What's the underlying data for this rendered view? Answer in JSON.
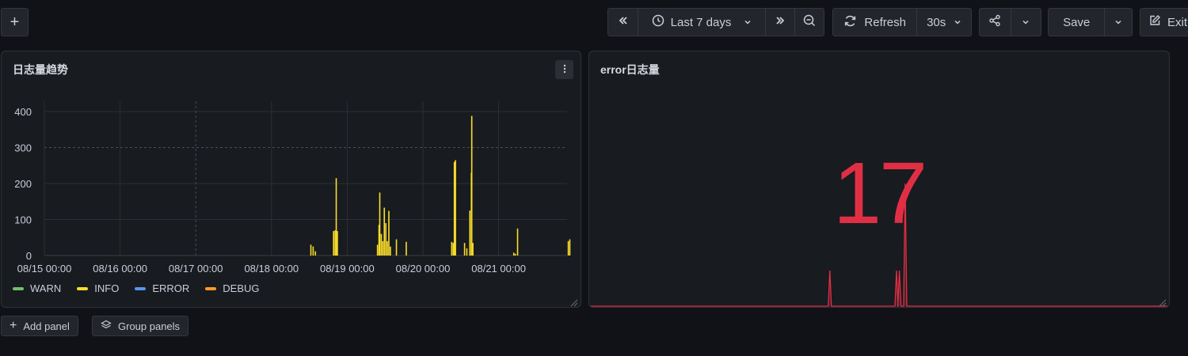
{
  "toolbar": {
    "add_label": "+",
    "time_range": "Last 7 days",
    "refresh_label": "Refresh",
    "refresh_interval": "30s",
    "save_label": "Save",
    "exit_label": "Exit"
  },
  "panels": [
    {
      "title": "日志量趋势",
      "legend": [
        {
          "label": "WARN",
          "color": "#73bf69"
        },
        {
          "label": "INFO",
          "color": "#fade2a"
        },
        {
          "label": "ERROR",
          "color": "#5794f2"
        },
        {
          "label": "DEBUG",
          "color": "#ff9830"
        }
      ]
    },
    {
      "title": "error日志量",
      "value": "17",
      "color": "#e02f44"
    }
  ],
  "bottom": {
    "add_panel": "Add panel",
    "group_panels": "Group panels"
  },
  "chart_data": {
    "type": "bar",
    "title": "日志量趋势",
    "x_ticks": [
      "08/15 00:00",
      "08/16 00:00",
      "08/17 00:00",
      "08/18 00:00",
      "08/19 00:00",
      "08/20 00:00",
      "08/21 00:00"
    ],
    "y_ticks": [
      0,
      100,
      200,
      300,
      400
    ],
    "ylim": [
      0,
      430
    ],
    "series": [
      {
        "name": "INFO",
        "color": "#fade2a",
        "points": [
          [
            3.52,
            30
          ],
          [
            3.55,
            25
          ],
          [
            3.58,
            12
          ],
          [
            3.82,
            68
          ],
          [
            3.84,
            70
          ],
          [
            3.855,
            215
          ],
          [
            3.87,
            68
          ],
          [
            4.4,
            30
          ],
          [
            4.42,
            85
          ],
          [
            4.43,
            175
          ],
          [
            4.45,
            60
          ],
          [
            4.47,
            40
          ],
          [
            4.49,
            133
          ],
          [
            4.51,
            90
          ],
          [
            4.53,
            40
          ],
          [
            4.55,
            124
          ],
          [
            4.57,
            25
          ],
          [
            4.65,
            45
          ],
          [
            4.78,
            38
          ],
          [
            5.38,
            38
          ],
          [
            5.4,
            35
          ],
          [
            5.415,
            260
          ],
          [
            5.43,
            265
          ],
          [
            5.55,
            35
          ],
          [
            5.58,
            20
          ],
          [
            5.62,
            125
          ],
          [
            5.64,
            230
          ],
          [
            5.645,
            388
          ],
          [
            5.66,
            35
          ],
          [
            6.2,
            8
          ],
          [
            6.22,
            5
          ],
          [
            6.25,
            75
          ],
          [
            6.92,
            40
          ],
          [
            6.94,
            45
          ],
          [
            7.12,
            2
          ],
          [
            7.15,
            2
          ]
        ]
      }
    ],
    "stat": {
      "title": "error日志量",
      "value": 17,
      "sparkline_points": [
        [
          0.415,
          45
        ],
        [
          0.53,
          45
        ],
        [
          0.535,
          45
        ],
        [
          0.545,
          155
        ]
      ]
    }
  }
}
